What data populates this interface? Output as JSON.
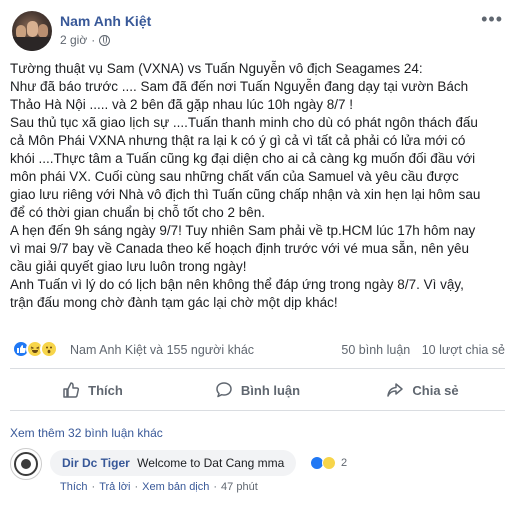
{
  "post": {
    "author": "Nam Anh Kiệt",
    "time": "2 giờ",
    "more_icon": "ellipsis-icon",
    "lines": [
      "Tường thuật vụ Sam (VXNA) vs Tuấn Nguyễn vô địch Seagames 24:",
      "Như đã báo trước .... Sam đã đến nơi Tuấn Nguyễn đang dạy tại vườn Bách",
      "Thảo Hà Nội ..... và 2 bên đã gặp nhau lúc 10h ngày 8/7 !",
      "Sau thủ tục xã giao lịch sự ....Tuấn thanh minh cho dù có phát ngôn thách đấu",
      "cả Môn Phái VXNA nhưng thật ra lại k có ý gì cả vì tất cả phải có lửa mới có",
      "khói ....Thực tâm a Tuấn cũng kg đại diện cho ai cả càng kg muốn đối đầu với",
      "môn phái VX. Cuối cùng sau những chất vấn của Samuel và yêu cầu được",
      "giao lưu riêng với Nhà vô địch thì Tuấn cũng chấp nhận và xin hẹn lại hôm sau",
      "để có thời gian chuẩn bị chỗ tốt cho 2 bên.",
      "A hẹn đến 9h sáng ngày 9/7! Tuy nhiên Sam phải về tp.HCM lúc 17h hôm nay",
      "vì mai 9/7 bay về Canada theo kế hoạch định trước với vé mua sẵn, nên yêu",
      "cầu giải quyết giao lưu luôn trong ngày!",
      "Anh Tuấn vì lý do có lịch bận nên không thể đáp ứng trong ngày 8/7. Vì vậy,",
      "trận đấu mong chờ đành tạm gác lại chờ một dịp khác!"
    ]
  },
  "reactions": {
    "names": "Nam Anh Kiệt và 155 người khác",
    "comments": "50 bình luận",
    "shares": "10 lượt chia sẻ",
    "icons": [
      "like-icon",
      "haha-icon",
      "wow-icon"
    ]
  },
  "actions": {
    "like": "Thích",
    "comment": "Bình luận",
    "share": "Chia sẻ"
  },
  "comments": {
    "more": "Xem thêm 32 bình luận khác",
    "items": [
      {
        "author": "Dir Dc Tiger",
        "text": "Welcome to Dat Cang mma",
        "reaction_count": "2",
        "like": "Thích",
        "reply": "Trả lời",
        "translate": "Xem bản dịch",
        "time": "47 phút"
      }
    ]
  },
  "colors": {
    "link": "#385898",
    "secondary": "#606770",
    "like_blue": "#2078f4",
    "emoji_yellow": "#f7d54a"
  }
}
